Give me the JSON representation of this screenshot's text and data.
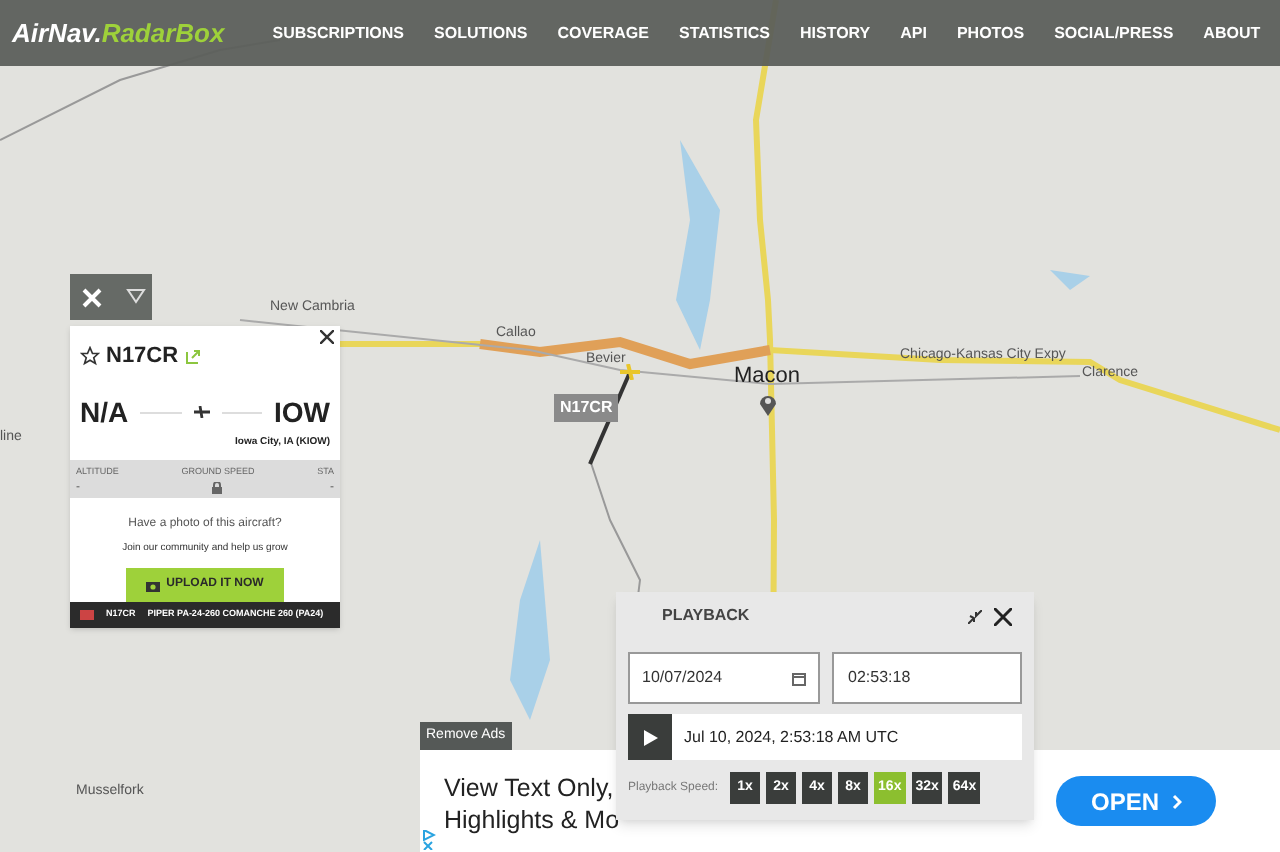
{
  "nav": {
    "logo_primary": "AirNav.",
    "logo_secondary": "RadarBox",
    "items": [
      {
        "label": "SUBSCRIPTIONS"
      },
      {
        "label": "SOLUTIONS"
      },
      {
        "label": "COVERAGE"
      },
      {
        "label": "STATISTICS"
      },
      {
        "label": "HISTORY"
      },
      {
        "label": "API"
      },
      {
        "label": "PHOTOS"
      },
      {
        "label": "SOCIAL/PRESS"
      },
      {
        "label": "ABOUT"
      }
    ]
  },
  "map": {
    "labels": [
      {
        "text": "New Cambria"
      },
      {
        "text": "Callao"
      },
      {
        "text": "Bevier"
      },
      {
        "text": "Chicago-Kansas City Expy"
      },
      {
        "text": "Clarence"
      },
      {
        "text": "line"
      },
      {
        "text": "Musselfork"
      }
    ],
    "city": "Macon",
    "aircraft_tag": "N17CR"
  },
  "flight_card": {
    "callsign": "N17CR",
    "origin": "N/A",
    "destination": "IOW",
    "destination_name": "Iowa City, IA (KIOW)",
    "stats": [
      {
        "label": "ALTITUDE",
        "value": "-"
      },
      {
        "label": "GROUND SPEED"
      },
      {
        "label": "STA",
        "value": "-"
      }
    ],
    "photo_prompt": "Have a photo of this aircraft?",
    "community_text": "Join our community and help us grow",
    "upload_button": "UPLOAD IT NOW",
    "footer_reg": "N17CR",
    "footer_type": "PIPER PA-24-260 COMANCHE 260 (PA24)"
  },
  "playback": {
    "title": "PLAYBACK",
    "date": "10/07/2024",
    "time": "02:53:18",
    "current": "Jul 10, 2024, 2:53:18 AM UTC",
    "speed_label": "Playback Speed:",
    "speeds": [
      {
        "label": "1x",
        "selected": false
      },
      {
        "label": "2x",
        "selected": false
      },
      {
        "label": "4x",
        "selected": false
      },
      {
        "label": "8x",
        "selected": false
      },
      {
        "label": "16x",
        "selected": true
      },
      {
        "label": "32x",
        "selected": false
      },
      {
        "label": "64x",
        "selected": false
      }
    ]
  },
  "remove_ads": "Remove Ads",
  "ad": {
    "line_1": "View Text Only,",
    "line_2": "Highlights & Mo",
    "button": "OPEN"
  }
}
